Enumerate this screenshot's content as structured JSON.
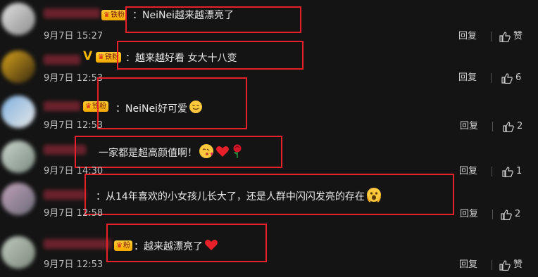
{
  "comments": [
    {
      "badge": "铁粉",
      "text": "：NeiNei越来越漂亮了",
      "date": "9月7日 15:27",
      "reply": "回复",
      "likes": "赞",
      "avatar_colors": [
        "#d9d9d9",
        "#8c8c8c"
      ],
      "emojis": []
    },
    {
      "badge": "铁粉",
      "vip": "V",
      "text": "：越来越好看  女大十八变",
      "date": "9月7日 12:53",
      "reply": "回复",
      "likes": "6",
      "avatar_colors": [
        "#d6a21c",
        "#3a2b10"
      ],
      "emojis": []
    },
    {
      "badge": "铁粉",
      "text": "：NeiNei好可爱",
      "date": "9月7日 12:53",
      "reply": "回复",
      "likes": "2",
      "avatar_colors": [
        "#7fb1e0",
        "#e6e6e6"
      ],
      "emojis": [
        "smile-emoji"
      ]
    },
    {
      "text": "一家都是超高颜值啊！",
      "date": "9月7日 14:30",
      "reply": "回复",
      "likes": "1",
      "avatar_colors": [
        "#c9d4cc",
        "#7a8a80"
      ],
      "emojis": [
        "kiss-emoji",
        "heart-emoji",
        "rose-emoji"
      ]
    },
    {
      "text": "：从14年喜欢的小女孩儿长大了，还是人群中闪闪发亮的存在",
      "date": "9月7日 12:58",
      "reply": "回复",
      "likes": "2",
      "avatar_colors": [
        "#c0a0b8",
        "#6c6c7a"
      ],
      "emojis": [
        "scream-emoji"
      ]
    },
    {
      "badge": "粉",
      "text": "：越来越漂亮了",
      "date": "9月7日 12:53",
      "reply": "回复",
      "likes": "赞",
      "avatar_colors": [
        "#bfc9bf",
        "#7d8a7d"
      ],
      "emojis": [
        "heart-emoji"
      ]
    }
  ]
}
